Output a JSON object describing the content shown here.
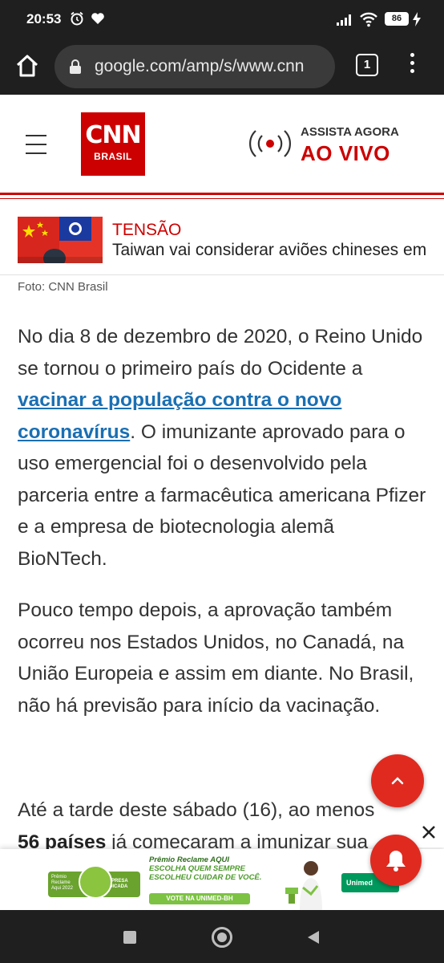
{
  "status_bar": {
    "time": "20:53",
    "battery": "86",
    "icons": [
      "alarm-icon",
      "heart-icon",
      "signal-icon",
      "wifi-icon",
      "battery-icon",
      "charging-icon"
    ]
  },
  "browser": {
    "url": "google.com/amp/s/www.cnn",
    "tab_count": "1",
    "icons": [
      "home-icon",
      "lock-icon",
      "menu-icon"
    ]
  },
  "site_header": {
    "logo_cnn": "CNN",
    "logo_brasil": "BRASIL",
    "live_top": "ASSISTA AGORA",
    "live_bottom": "AO VIVO",
    "brand_color": "#cc0000"
  },
  "teaser": {
    "category": "TENSÃO",
    "title": "Taiwan vai considerar aviões chineses em"
  },
  "photo_caption": "Foto: CNN Brasil",
  "article": {
    "p1_before": "No dia 8 de dezembro de 2020, o Reino Unido se tornou o primeiro país do Ocidente a ",
    "p1_link": "vacinar a população contra o novo coronavírus",
    "p1_after": ". O imunizante aprovado para o uso emergencial foi o desenvolvido pela parceria entre a farmacêutica americana Pfizer e a empresa de biotecnologia alemã BioNTech.",
    "p2": "Pouco tempo depois, a aprovação também ocorreu nos Estados Unidos, no Canadá, na União Europeia e assim em diante. No Brasil, não há previsão para início da vacinação.",
    "p3_line1": "Até a tarde deste sábado (16), ao menos",
    "p3_bold": "56 países",
    "p3_rest": " já começaram a imunizar sua"
  },
  "ad": {
    "badge_left": "Prêmio Reclame Aqui 2022",
    "badge_right": "EMPRESA INDICADA",
    "headline_1": "Prêmio Reclame AQUI",
    "headline_2": "ESCOLHA QUEM SEMPRE",
    "headline_3": "ESCOLHEU CUIDAR DE VOCÊ.",
    "cta": "VOTE NA UNIMED-BH",
    "brand": "Unimed"
  },
  "colors": {
    "accent": "#cc0000",
    "link": "#1a6fb3",
    "fab": "#e02a20",
    "ad_green": "#6aa32e"
  }
}
